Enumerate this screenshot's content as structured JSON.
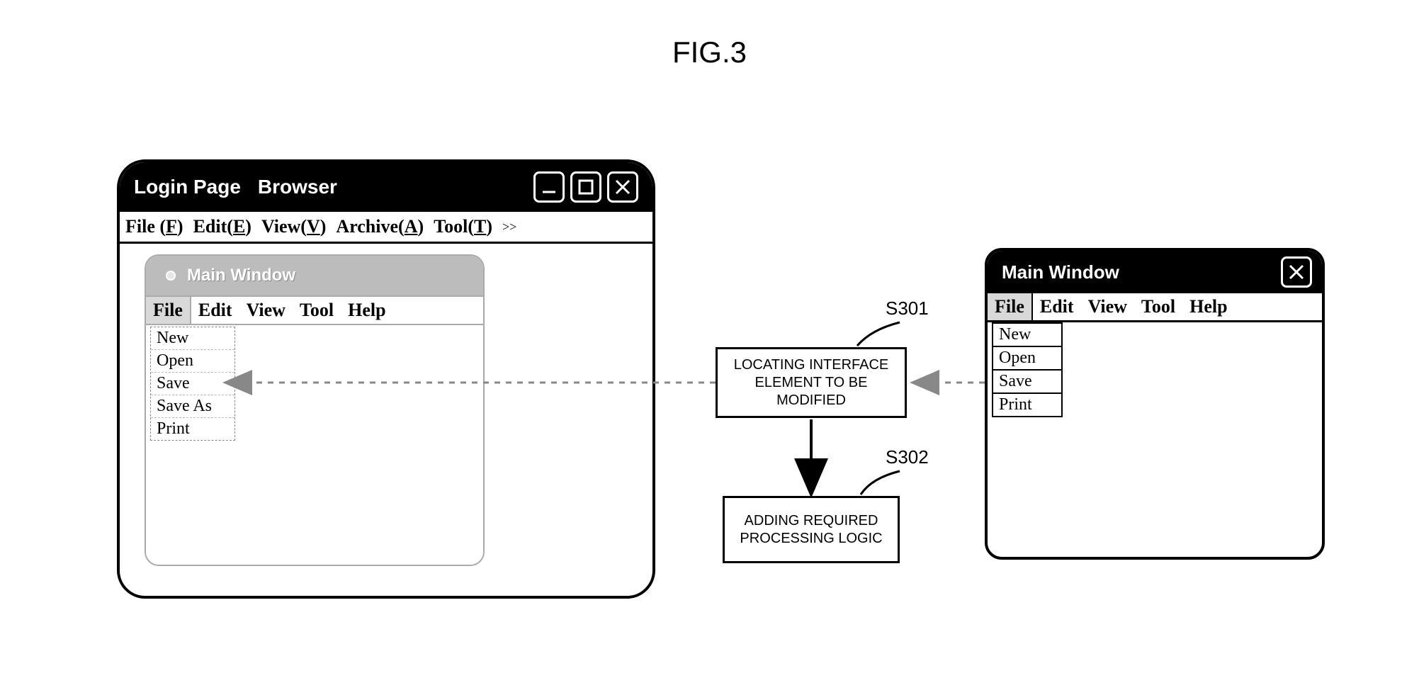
{
  "figure_title": "FIG.3",
  "browser": {
    "title_left": "Login Page",
    "title_right": "Browser",
    "menubar": [
      {
        "pre": "File (",
        "key": "F",
        "post": ")"
      },
      {
        "pre": "Edit(",
        "key": "E",
        "post": ")"
      },
      {
        "pre": "View(",
        "key": "V",
        "post": ")"
      },
      {
        "pre": "Archive(",
        "key": "A",
        "post": ")"
      },
      {
        "pre": "Tool(",
        "key": "T",
        "post": ")"
      }
    ],
    "more": ">>"
  },
  "inner_window": {
    "title": "Main Window",
    "menubar": [
      "File",
      "Edit",
      "View",
      "Tool",
      "Help"
    ],
    "file_menu_items": [
      "New",
      "Open",
      "Save",
      "Save As",
      "Print"
    ]
  },
  "right_window": {
    "title": "Main Window",
    "menubar": [
      "File",
      "Edit",
      "View",
      "Tool",
      "Help"
    ],
    "file_menu_items": [
      "New",
      "Open",
      "Save",
      "Print"
    ]
  },
  "flow": {
    "step1_label": "S301",
    "step1_text": "LOCATING INTERFACE ELEMENT TO BE MODIFIED",
    "step2_label": "S302",
    "step2_text": "ADDING REQUIRED PROCESSING LOGIC"
  }
}
